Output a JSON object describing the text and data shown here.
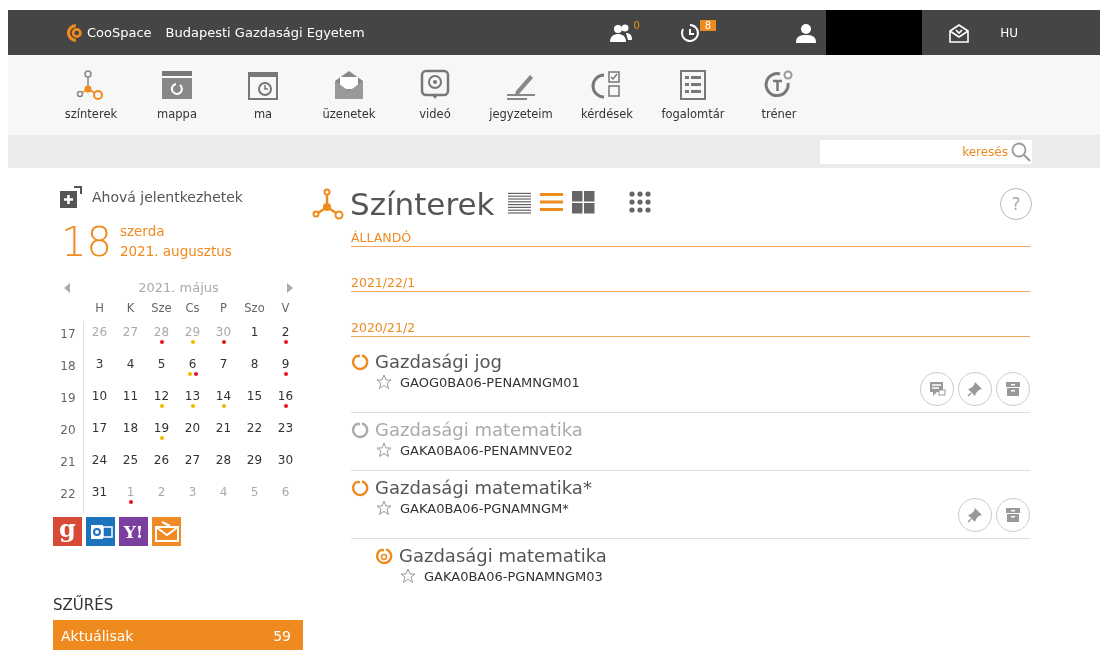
{
  "topbar": {
    "brand": "CooSpace",
    "institution": "Budapesti Gazdasági Egyetem",
    "people_badge": "0",
    "history_badge": "8",
    "language": "HU"
  },
  "toolbar": [
    {
      "kind": "scenes",
      "label": "színterek"
    },
    {
      "kind": "folder",
      "label": "mappa"
    },
    {
      "kind": "today",
      "label": "ma"
    },
    {
      "kind": "messages",
      "label": "üzenetek"
    },
    {
      "kind": "video",
      "label": "videó"
    },
    {
      "kind": "notes",
      "label": "jegyzeteim"
    },
    {
      "kind": "questions",
      "label": "kérdések"
    },
    {
      "kind": "glossary",
      "label": "fogalomtár"
    },
    {
      "kind": "trainer",
      "label": "tréner"
    }
  ],
  "search": {
    "placeholder": "keresés"
  },
  "sidebar": {
    "enroll_link": "Ahová jelentkezhetek",
    "today": {
      "day": "18",
      "weekday": "szerda",
      "month": "2021. augusztus"
    },
    "calendar": {
      "month": "2021. május",
      "weekdays": [
        "H",
        "K",
        "Sze",
        "Cs",
        "P",
        "Szo",
        "V"
      ],
      "weeks": [
        {
          "number": "17",
          "days": [
            {
              "day": "26",
              "muted": true
            },
            {
              "day": "27",
              "muted": true
            },
            {
              "day": "28",
              "muted": true,
              "dots": [
                {
                  "color": "#e8141c"
                }
              ]
            },
            {
              "day": "29",
              "muted": true,
              "dots": [
                {
                  "color": "#f5b800"
                }
              ]
            },
            {
              "day": "30",
              "muted": true,
              "dots": [
                {
                  "color": "#e8141c"
                }
              ]
            },
            {
              "day": "1",
              "muted": false
            },
            {
              "day": "2",
              "muted": false,
              "dots": [
                {
                  "color": "#e8141c"
                }
              ]
            }
          ]
        },
        {
          "number": "18",
          "days": [
            {
              "day": "3",
              "muted": false
            },
            {
              "day": "4",
              "muted": false
            },
            {
              "day": "5",
              "muted": false
            },
            {
              "day": "6",
              "muted": false,
              "dots": [
                {
                  "color": "#f5b800"
                },
                {
                  "color": "#e8141c"
                }
              ]
            },
            {
              "day": "7",
              "muted": false
            },
            {
              "day": "8",
              "muted": false
            },
            {
              "day": "9",
              "muted": false,
              "dots": [
                {
                  "color": "#e8141c"
                }
              ]
            }
          ]
        },
        {
          "number": "19",
          "days": [
            {
              "day": "10",
              "muted": false
            },
            {
              "day": "11",
              "muted": false
            },
            {
              "day": "12",
              "muted": false,
              "dots": [
                {
                  "color": "#f5b800"
                }
              ]
            },
            {
              "day": "13",
              "muted": false,
              "dots": [
                {
                  "color": "#f5b800"
                }
              ]
            },
            {
              "day": "14",
              "muted": false,
              "dots": [
                {
                  "color": "#f5b800"
                }
              ]
            },
            {
              "day": "15",
              "muted": false
            },
            {
              "day": "16",
              "muted": false,
              "dots": [
                {
                  "color": "#e8141c"
                }
              ]
            }
          ]
        },
        {
          "number": "20",
          "days": [
            {
              "day": "17",
              "muted": false
            },
            {
              "day": "18",
              "muted": false
            },
            {
              "day": "19",
              "muted": false,
              "dots": [
                {
                  "color": "#f5b800"
                }
              ]
            },
            {
              "day": "20",
              "muted": false
            },
            {
              "day": "21",
              "muted": false
            },
            {
              "day": "22",
              "muted": false
            },
            {
              "day": "23",
              "muted": false
            }
          ]
        },
        {
          "number": "21",
          "days": [
            {
              "day": "24",
              "muted": false
            },
            {
              "day": "25",
              "muted": false
            },
            {
              "day": "26",
              "muted": false
            },
            {
              "day": "27",
              "muted": false
            },
            {
              "day": "28",
              "muted": false
            },
            {
              "day": "29",
              "muted": false
            },
            {
              "day": "30",
              "muted": false
            }
          ]
        },
        {
          "number": "22",
          "days": [
            {
              "day": "31",
              "muted": false
            },
            {
              "day": "1",
              "muted": true,
              "dots": [
                {
                  "color": "#e8141c"
                }
              ]
            },
            {
              "day": "2",
              "muted": true
            },
            {
              "day": "3",
              "muted": true
            },
            {
              "day": "4",
              "muted": true
            },
            {
              "day": "5",
              "muted": true
            },
            {
              "day": "6",
              "muted": true
            }
          ]
        }
      ]
    },
    "export_buttons": [
      {
        "kind": "google",
        "label": "g"
      },
      {
        "kind": "outlook"
      },
      {
        "kind": "yahoo",
        "label": "Y!"
      },
      {
        "kind": "mail"
      }
    ],
    "filter_title": "SZŰRÉS",
    "filters": [
      {
        "label": "Aktuálisak",
        "count": "59",
        "selected": true
      }
    ]
  },
  "main": {
    "title": "Színterek",
    "help": "?",
    "view_modes": [
      {
        "kind": "compact",
        "selected": false
      },
      {
        "kind": "list",
        "selected": true
      },
      {
        "kind": "tiles",
        "selected": false
      },
      {
        "kind": "grid",
        "selected": false
      }
    ],
    "sections": [
      {
        "title": "ÁLLANDÓ"
      },
      {
        "title": "2021/22/1"
      },
      {
        "title": "2020/21/2",
        "courses": [
          {
            "kind": "course",
            "active": true,
            "title": "Gazdasági jog",
            "code": "GAOG0BA06-PENAMNGM01",
            "starred": false,
            "actions": [
              {
                "kind": "forum"
              },
              {
                "kind": "pin"
              },
              {
                "kind": "archive"
              }
            ]
          },
          {
            "kind": "course",
            "active": false,
            "title": "Gazdasági matematika",
            "code": "GAKA0BA06-PENAMNVE02",
            "starred": false
          },
          {
            "kind": "course",
            "active": true,
            "title": "Gazdasági matematika*",
            "code": "GAKA0BA06-PGNAMNGM*",
            "starred": false,
            "actions": [
              {
                "kind": "pin"
              },
              {
                "kind": "archive"
              }
            ]
          },
          {
            "kind": "subcourse",
            "active": true,
            "title": "Gazdasági matematika",
            "code": "GAKA0BA06-PGNAMNGM03",
            "starred": false
          }
        ]
      }
    ]
  }
}
